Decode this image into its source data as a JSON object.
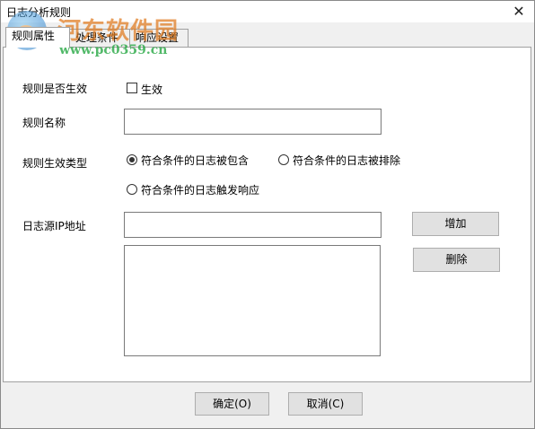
{
  "window": {
    "title": "日志分析规则"
  },
  "watermark": {
    "title": "河东软件园",
    "url": "www.pc0359.cn"
  },
  "tabs": [
    {
      "label": "规则属性"
    },
    {
      "label": "处理条件"
    },
    {
      "label": "响应设置"
    }
  ],
  "form": {
    "enabled": {
      "label": "规则是否生效",
      "checkbox_label": "生效",
      "checked": false
    },
    "name": {
      "label": "规则名称",
      "value": ""
    },
    "type": {
      "label": "规则生效类型",
      "options": [
        {
          "label": "符合条件的日志被包含",
          "selected": true
        },
        {
          "label": "符合条件的日志被排除",
          "selected": false
        },
        {
          "label": "符合条件的日志触发响应",
          "selected": false
        }
      ]
    },
    "source_ip": {
      "label": "日志源IP地址",
      "value": "",
      "list_items": []
    },
    "add_button": "增加",
    "delete_button": "删除"
  },
  "footer": {
    "ok_button": "确定(O)",
    "cancel_button": "取消(C)"
  },
  "icons": {
    "close": "close-icon"
  }
}
